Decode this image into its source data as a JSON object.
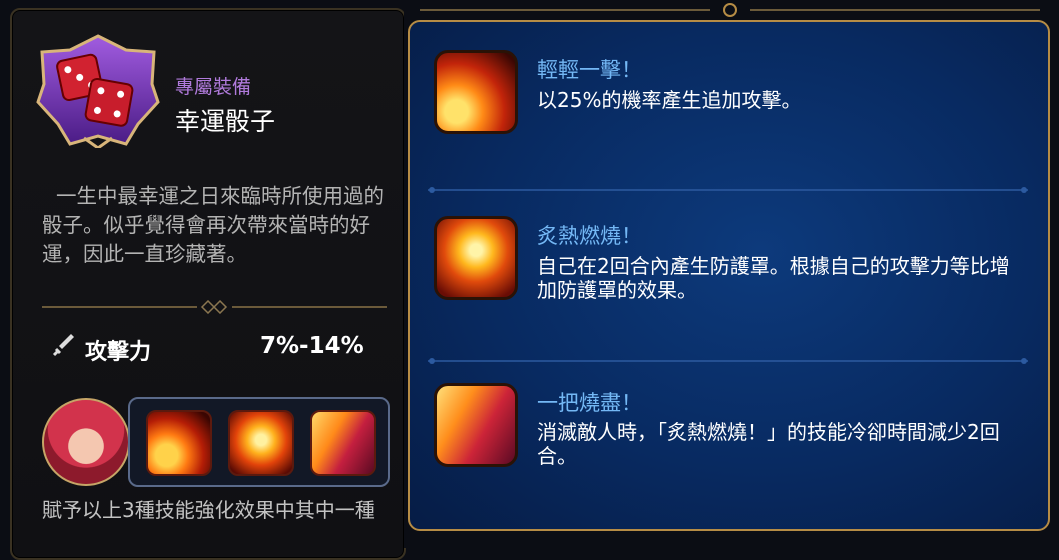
{
  "item": {
    "type_label": "專屬裝備",
    "name": "幸運骰子",
    "description": "一生中最幸運之日來臨時所使用過的骰子。似乎覺得會再次帶來當時的好運，因此一直珍藏著。",
    "icon": "dice-icon"
  },
  "stat": {
    "icon": "sword-icon",
    "label": "攻擊力",
    "value": "7%-14%"
  },
  "footer": "賦予以上3種技能強化效果中其中一種",
  "skills": [
    {
      "title": "輕輕一擊！",
      "desc": "以25%的機率產生追加攻擊。",
      "icon": "fire-slash-icon"
    },
    {
      "title": "炙熱燃燒！",
      "desc": "自己在2回合內產生防護罩。根據自己的攻擊力等比增加防護罩的效果。",
      "icon": "fire-phoenix-icon"
    },
    {
      "title": "一把燒盡！",
      "desc": "消滅敵人時，「炙熱燃燒！」的技能冷卻時間減少2回合。",
      "icon": "fire-burst-icon"
    }
  ],
  "colors": {
    "accent_gold": "#b68c45",
    "panel_blue": "#082a61",
    "skill_title": "#74b8f5",
    "item_type": "#b07adb"
  }
}
